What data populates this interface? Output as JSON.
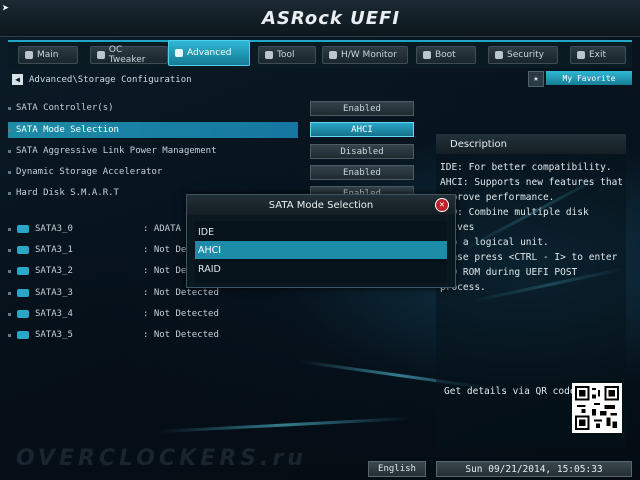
{
  "brand": "ASRock UEFI",
  "tabs": [
    {
      "label": "Main",
      "icon": "main-icon"
    },
    {
      "label": "OC Tweaker",
      "icon": "oc-icon"
    },
    {
      "label": "Advanced",
      "icon": "advanced-icon",
      "active": true
    },
    {
      "label": "Tool",
      "icon": "tool-icon"
    },
    {
      "label": "H/W Monitor",
      "icon": "monitor-icon"
    },
    {
      "label": "Boot",
      "icon": "boot-icon"
    },
    {
      "label": "Security",
      "icon": "security-icon"
    },
    {
      "label": "Exit",
      "icon": "exit-icon"
    }
  ],
  "breadcrumb": "Advanced\\Storage Configuration",
  "favorite_label": "My Favorite",
  "settings": [
    {
      "label": "SATA Controller(s)",
      "value": "Enabled"
    },
    {
      "label": "SATA Mode Selection",
      "value": "AHCI",
      "selected": true
    },
    {
      "label": "SATA Aggressive Link Power Management",
      "value": "Disabled"
    },
    {
      "label": "Dynamic Storage Accelerator",
      "value": "Enabled"
    },
    {
      "label": "Hard Disk S.M.A.R.T",
      "value": "Enabled"
    }
  ],
  "drives": [
    {
      "name": "SATA3_0",
      "status": ": ADATA"
    },
    {
      "name": "SATA3_1",
      "status": ": Not Det"
    },
    {
      "name": "SATA3_2",
      "status": ": Not Det"
    },
    {
      "name": "SATA3_3",
      "status": ": Not Detected"
    },
    {
      "name": "SATA3_4",
      "status": ": Not Detected"
    },
    {
      "name": "SATA3_5",
      "status": ": Not Detected"
    }
  ],
  "description": {
    "title": "Description",
    "text": "IDE: For better compatibility.\nAHCI: Supports new features that\n  prove performance.\n  D: Combine multiple disk drives\n  o a logical unit.\n  ase press <CTRL - I> to enter\n  D ROM during UEFI POST process.",
    "qr_label": "Get details via QR code"
  },
  "modal": {
    "title": "SATA Mode Selection",
    "close_symbol": "✕",
    "options": [
      "IDE",
      "AHCI",
      "RAID"
    ],
    "selected_index": 1
  },
  "watermark": "OVERCLOCKERS.ru",
  "footer": {
    "language": "English",
    "datetime": "Sun 09/21/2014, 15:05:33"
  },
  "colors": {
    "accent": "#1d8ca8",
    "close": "#c11f2a"
  }
}
